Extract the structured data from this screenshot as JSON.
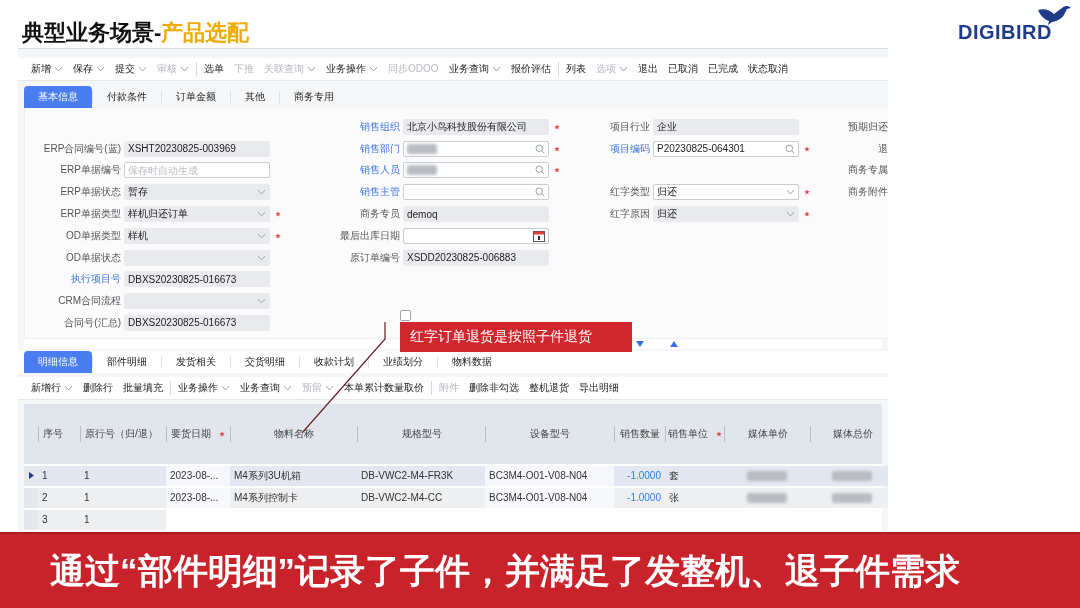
{
  "header": {
    "title": "典型业务场景-",
    "title_highlight": "产品选配",
    "logo": "DIGIBIRD"
  },
  "toolbar": {
    "groups": [
      [
        {
          "label": "新增",
          "dropdown": true,
          "disabled": false
        },
        {
          "label": "保存",
          "dropdown": true,
          "disabled": false
        },
        {
          "label": "提交",
          "dropdown": true,
          "disabled": false
        },
        {
          "label": "审核",
          "dropdown": true,
          "disabled": true
        }
      ],
      [
        {
          "label": "选单",
          "disabled": false
        },
        {
          "label": "下推",
          "disabled": true
        },
        {
          "label": "关联查询",
          "dropdown": true,
          "disabled": true
        },
        {
          "label": "业务操作",
          "dropdown": true,
          "disabled": false
        },
        {
          "label": "同步ODOO",
          "disabled": true
        },
        {
          "label": "业务查询",
          "dropdown": true,
          "disabled": false
        },
        {
          "label": "报价评估",
          "disabled": false
        }
      ],
      [
        {
          "label": "列表",
          "disabled": false
        },
        {
          "label": "选项",
          "dropdown": true,
          "disabled": true
        },
        {
          "label": "退出",
          "disabled": false
        },
        {
          "label": "已取消",
          "disabled": false
        },
        {
          "label": "已完成",
          "disabled": false
        },
        {
          "label": "状态取消",
          "disabled": false
        }
      ]
    ]
  },
  "tabs": [
    {
      "label": "基本信息",
      "selected": true
    },
    {
      "label": "付款条件",
      "selected": false
    },
    {
      "label": "订单金额",
      "selected": false
    },
    {
      "label": "其他",
      "selected": false
    },
    {
      "label": "商务专用",
      "selected": false
    }
  ],
  "form": {
    "rows": [
      {
        "cells": [
          null,
          {
            "kind": "text",
            "label": "销售组织",
            "link": true,
            "value": "北京小鸟科技股份有限公司",
            "required": true
          },
          {
            "kind": "text",
            "label": "项目行业",
            "value": "企业"
          },
          {
            "kind": "label",
            "label": "预期归还"
          }
        ]
      },
      {
        "cells": [
          {
            "kind": "text",
            "label": "ERP合同编号(蓝)",
            "value": "XSHT20230825-003969"
          },
          {
            "kind": "lookup",
            "label": "销售部门",
            "link": true,
            "blurred": true,
            "required": true
          },
          {
            "kind": "lookup",
            "label": "项目编码",
            "link": true,
            "value": "P20230825-064301",
            "required": true
          },
          {
            "kind": "label",
            "label": "退"
          }
        ]
      },
      {
        "cells": [
          {
            "kind": "input",
            "label": "ERP单据编号",
            "placeholder": "保存时自动生成"
          },
          {
            "kind": "lookup",
            "label": "销售人员",
            "link": true,
            "blurred": true,
            "required": true
          },
          null,
          {
            "kind": "label",
            "label": "商务专属"
          }
        ]
      },
      {
        "cells": [
          {
            "kind": "select",
            "label": "ERP单据状态",
            "value": "暂存",
            "editable": false
          },
          {
            "kind": "lookup",
            "label": "销售主管",
            "link": true
          },
          {
            "kind": "select",
            "label": "红字类型",
            "value": "归还",
            "editable": true,
            "required": true
          },
          {
            "kind": "label",
            "label": "商务附件"
          }
        ]
      },
      {
        "cells": [
          {
            "kind": "select",
            "label": "ERP单据类型",
            "value": "样机归还订单",
            "editable": false,
            "required": true
          },
          {
            "kind": "text",
            "label": "商务专员",
            "value": "demoq"
          },
          {
            "kind": "select",
            "label": "红字原因",
            "value": "归还",
            "editable": false,
            "required": true
          },
          null
        ]
      },
      {
        "cells": [
          {
            "kind": "select",
            "label": "OD单据类型",
            "value": "样机",
            "editable": false,
            "required": true
          },
          {
            "kind": "date",
            "label": "最后出库日期"
          },
          null,
          null
        ]
      },
      {
        "cells": [
          {
            "kind": "select",
            "label": "OD单据状态",
            "editable": false
          },
          {
            "kind": "text",
            "label": "原订单编号",
            "value": "XSDD20230825-006883"
          },
          null,
          null
        ]
      },
      {
        "cells": [
          {
            "kind": "text",
            "label": "执行项目号",
            "link": true,
            "value": "DBXS20230825-016673"
          },
          null,
          null,
          null
        ]
      },
      {
        "cells": [
          {
            "kind": "select",
            "label": "CRM合同流程",
            "editable": false
          },
          null,
          null,
          null
        ]
      },
      {
        "cells": [
          {
            "kind": "text",
            "label": "合同号(汇总)",
            "value": "DBXS20230825-016673"
          },
          {
            "kind": "checkbox",
            "checked": false
          },
          null,
          null
        ]
      }
    ]
  },
  "callout": {
    "text": "红字订单退货是按照子件退货"
  },
  "detail_tabs": [
    {
      "label": "明细信息",
      "selected": true
    },
    {
      "label": "部件明细",
      "selected": false
    },
    {
      "label": "发货相关",
      "selected": false
    },
    {
      "label": "交货明细",
      "selected": false
    },
    {
      "label": "收款计划",
      "selected": false
    },
    {
      "label": "业绩划分",
      "selected": false
    },
    {
      "label": "物料数据",
      "selected": false
    }
  ],
  "detail_toolbar": {
    "groups": [
      [
        {
          "label": "新增行",
          "dropdown": true,
          "disabled": false
        },
        {
          "label": "删除行",
          "disabled": false
        },
        {
          "label": "批量填充",
          "disabled": false
        }
      ],
      [
        {
          "label": "业务操作",
          "dropdown": true,
          "disabled": false
        },
        {
          "label": "业务查询",
          "dropdown": true,
          "disabled": false
        },
        {
          "label": "预留",
          "dropdown": true,
          "disabled": true
        },
        {
          "label": "本单累计数量取价",
          "disabled": false
        }
      ],
      [
        {
          "label": "附件",
          "disabled": true
        },
        {
          "label": "删除非勾选",
          "disabled": false
        },
        {
          "label": "整机退货",
          "disabled": false
        },
        {
          "label": "导出明细",
          "disabled": false
        }
      ]
    ]
  },
  "table": {
    "columns": [
      {
        "label": "序号"
      },
      {
        "label": "原行号（归/退）"
      },
      {
        "label": "要货日期",
        "required": true
      },
      {
        "label": "物料名称"
      },
      {
        "label": "规格型号"
      },
      {
        "label": "设备型号"
      },
      {
        "label": "销售数量"
      },
      {
        "label": "销售单位",
        "required": true
      },
      {
        "label": "媒体单价"
      },
      {
        "label": "媒体总价"
      }
    ],
    "rows": [
      {
        "current": true,
        "prices_blurred": true,
        "cells": [
          "1",
          "1",
          "2023-08-...",
          "M4系列3U机箱",
          "DB-VWC2-M4-FR3K",
          "BC3M4-O01-V08-N04",
          "-1.0000",
          "套"
        ]
      },
      {
        "current": false,
        "prices_blurred": true,
        "cells": [
          "2",
          "1",
          "2023-08-...",
          "M4系列控制卡",
          "DB-VWC2-M4-CC",
          "BC3M4-O01-V08-N04",
          "-1.0000",
          "张"
        ]
      },
      {
        "current": false,
        "cells": [
          "3",
          "1"
        ]
      }
    ]
  },
  "banner": {
    "text": "通过“部件明细”记录了子件，并满足了发整机、退子件需求"
  }
}
